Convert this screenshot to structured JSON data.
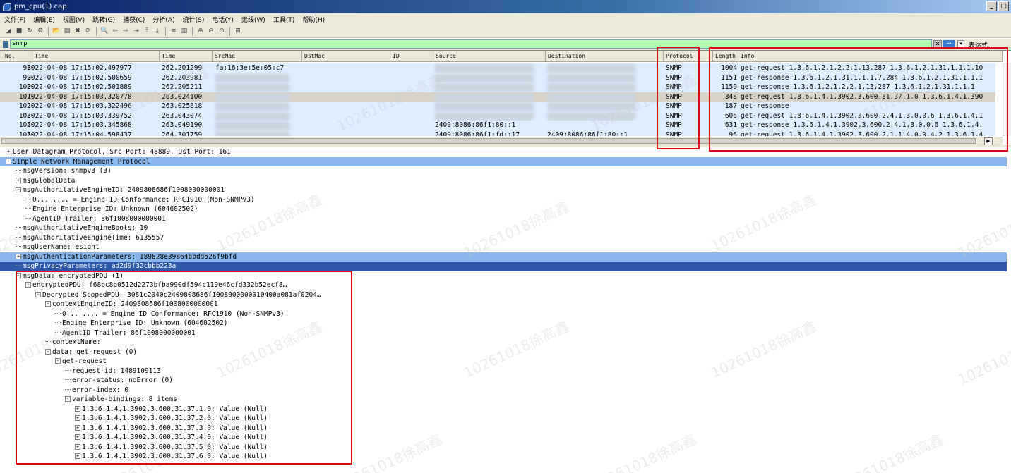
{
  "window": {
    "title": "pm_cpu(1).cap",
    "min_label": "_",
    "max_label": "□"
  },
  "menu": [
    "文件(F)",
    "编辑(E)",
    "视图(V)",
    "跳转(G)",
    "捕获(C)",
    "分析(A)",
    "统计(S)",
    "电话(Y)",
    "无线(W)",
    "工具(T)",
    "帮助(H)"
  ],
  "toolbar_icons": [
    "shark-fin-icon",
    "stop-icon",
    "restart-icon",
    "options-icon",
    "open-folder-icon",
    "save-icon",
    "close-file-icon",
    "reload-icon",
    "find-icon",
    "back-icon",
    "forward-icon",
    "goto-icon",
    "first-icon",
    "last-icon",
    "autoscroll-icon",
    "colorize-icon",
    "zoom-in-icon",
    "zoom-out-icon",
    "zoom-reset-icon",
    "resize-columns-icon"
  ],
  "filter": {
    "value": "snmp",
    "expression_label": "表达式…",
    "clear": "✕",
    "apply": "→",
    "drop": "▾"
  },
  "columns": [
    "No.",
    "Time",
    "Time",
    "SrcMac",
    "DstMac",
    "ID",
    "Source",
    "Destination",
    "Protocol",
    "Length",
    "Info"
  ],
  "packets": [
    {
      "no": "98",
      "time": "2022-04-08 17:15:02.497977",
      "rel": "262.201299",
      "srcmac": "fa:16:3e:5e:05:c7",
      "source": "",
      "dest": "",
      "proto": "SNMP",
      "len": "1004",
      "info": "get-request 1.3.6.1.2.1.2.2.1.13.287 1.3.6.1.2.1.31.1.1.1.10"
    },
    {
      "no": "99",
      "time": "2022-04-08 17:15:02.500659",
      "rel": "262.203981",
      "srcmac": "",
      "source": "",
      "dest": "",
      "proto": "SNMP",
      "len": "1151",
      "info": "get-response 1.3.6.1.2.1.31.1.1.1.7.284 1.3.6.1.2.1.31.1.1.1"
    },
    {
      "no": "100",
      "time": "2022-04-08 17:15:02.501889",
      "rel": "262.205211",
      "srcmac": "",
      "source": "",
      "dest": "",
      "proto": "SNMP",
      "len": "1159",
      "info": "get-response 1.3.6.1.2.1.2.2.1.13.287 1.3.6.1.2.1.31.1.1.1"
    },
    {
      "no": "101",
      "time": "2022-04-08 17:15:03.320778",
      "rel": "263.024100",
      "srcmac": "",
      "source": "",
      "dest": "",
      "proto": "SNMP",
      "len": "348",
      "info": "get-request 1.3.6.1.4.1.3902.3.600.31.37.1.0 1.3.6.1.4.1.390"
    },
    {
      "no": "102",
      "time": "2022-04-08 17:15:03.322496",
      "rel": "263.025818",
      "srcmac": "",
      "source": "",
      "dest": "",
      "proto": "SNMP",
      "len": "187",
      "info": "get-response"
    },
    {
      "no": "103",
      "time": "2022-04-08 17:15:03.339752",
      "rel": "263.043074",
      "srcmac": "",
      "source": "",
      "dest": "",
      "proto": "SNMP",
      "len": "606",
      "info": "get-request 1.3.6.1.4.1.3902.3.600.2.4.1.3.0.0.6 1.3.6.1.4.1"
    },
    {
      "no": "104",
      "time": "2022-04-08 17:15:03.345868",
      "rel": "263.049190",
      "srcmac": "",
      "source": "2409:8086:86f1:80::1",
      "dest": "",
      "proto": "SNMP",
      "len": "631",
      "info": "get-response 1.3.6.1.4.1.3902.3.600.2.4.1.3.0.0.6 1.3.6.1.4."
    },
    {
      "no": "106",
      "time": "2022-04-08 17:15:04.598437",
      "rel": "264.301759",
      "srcmac": "",
      "source": "2409:8086:86f1:fd::17",
      "dest": "2409:8086:86f1:80::1",
      "proto": "SNMP",
      "len": "96",
      "info": "get-request 1.3.6.1.4.1.3902.3.600.2.1.1.4.0.0.4.2 1.3.6.1.4"
    }
  ],
  "details": [
    {
      "indent": 0,
      "exp": "+",
      "text": "User Datagram Protocol, Src Port: 48889, Dst Port: 161",
      "hl": ""
    },
    {
      "indent": 0,
      "exp": "-",
      "text": "Simple Network Management Protocol",
      "hl": "light"
    },
    {
      "indent": 1,
      "exp": "",
      "text": "msgVersion: snmpv3 (3)",
      "hl": ""
    },
    {
      "indent": 1,
      "exp": "+",
      "text": "msgGlobalData",
      "hl": ""
    },
    {
      "indent": 1,
      "exp": "-",
      "text": "msgAuthoritativeEngineID: 2409808686f1008000000001",
      "hl": ""
    },
    {
      "indent": 2,
      "exp": "",
      "text": "0... .... = Engine ID Conformance: RFC1910 (Non-SNMPv3)",
      "hl": ""
    },
    {
      "indent": 2,
      "exp": "",
      "text": "Engine Enterprise ID: Unknown (604602502)",
      "hl": ""
    },
    {
      "indent": 2,
      "exp": "",
      "text": "AgentID Trailer: 86f1008000000001",
      "hl": ""
    },
    {
      "indent": 1,
      "exp": "",
      "text": "msgAuthoritativeEngineBoots: 10",
      "hl": ""
    },
    {
      "indent": 1,
      "exp": "",
      "text": "msgAuthoritativeEngineTime: 6135557",
      "hl": ""
    },
    {
      "indent": 1,
      "exp": "",
      "text": "msgUserName: esight",
      "hl": ""
    },
    {
      "indent": 1,
      "exp": "+",
      "text": "msgAuthenticationParameters: 189828e39864bbdd526f9bfd",
      "hl": "light"
    },
    {
      "indent": 1,
      "exp": "",
      "text": "msgPrivacyParameters: ad2d9f32cbbb223a",
      "hl": "dark"
    },
    {
      "indent": 1,
      "exp": "-",
      "text": "msgData: encryptedPDU (1)",
      "hl": ""
    },
    {
      "indent": 2,
      "exp": "-",
      "text": "encryptedPDU: f68bc8b0512d2273bfba990df594c119e46cfd332b52ecf8…",
      "hl": ""
    },
    {
      "indent": 3,
      "exp": "-",
      "text": "Decrypted ScopedPDU: 3081c2040c2409808686f1008000000010400a081af0204…",
      "hl": ""
    },
    {
      "indent": 4,
      "exp": "-",
      "text": "contextEngineID: 2409808686f1008000000001",
      "hl": ""
    },
    {
      "indent": 5,
      "exp": "",
      "text": "0... .... = Engine ID Conformance: RFC1910 (Non-SNMPv3)",
      "hl": ""
    },
    {
      "indent": 5,
      "exp": "",
      "text": "Engine Enterprise ID: Unknown (604602502)",
      "hl": ""
    },
    {
      "indent": 5,
      "exp": "",
      "text": "AgentID Trailer: 86f1008000000001",
      "hl": ""
    },
    {
      "indent": 4,
      "exp": "",
      "text": "contextName:",
      "hl": ""
    },
    {
      "indent": 4,
      "exp": "-",
      "text": "data: get-request (0)",
      "hl": ""
    },
    {
      "indent": 5,
      "exp": "-",
      "text": "get-request",
      "hl": ""
    },
    {
      "indent": 6,
      "exp": "",
      "text": "request-id: 1489109113",
      "hl": ""
    },
    {
      "indent": 6,
      "exp": "",
      "text": "error-status: noError (0)",
      "hl": ""
    },
    {
      "indent": 6,
      "exp": "",
      "text": "error-index: 0",
      "hl": ""
    },
    {
      "indent": 6,
      "exp": "-",
      "text": "variable-bindings: 8 items",
      "hl": ""
    },
    {
      "indent": 7,
      "exp": "+",
      "text": "1.3.6.1.4.1.3902.3.600.31.37.1.0: Value (Null)",
      "hl": ""
    },
    {
      "indent": 7,
      "exp": "+",
      "text": "1.3.6.1.4.1.3902.3.600.31.37.2.0: Value (Null)",
      "hl": ""
    },
    {
      "indent": 7,
      "exp": "+",
      "text": "1.3.6.1.4.1.3902.3.600.31.37.3.0: Value (Null)",
      "hl": ""
    },
    {
      "indent": 7,
      "exp": "+",
      "text": "1.3.6.1.4.1.3902.3.600.31.37.4.0: Value (Null)",
      "hl": ""
    },
    {
      "indent": 7,
      "exp": "+",
      "text": "1.3.6.1.4.1.3902.3.600.31.37.5.0: Value (Null)",
      "hl": ""
    },
    {
      "indent": 7,
      "exp": "+",
      "text": "1.3.6.1.4.1.3902.3.600.31.37.6.0: Value (Null)",
      "hl": ""
    }
  ],
  "watermark": "10261018徐高鑫",
  "colors": {
    "filter_bg": "#afffaf",
    "row_bg": "#dceeff",
    "selected_row": "#d9d2c7",
    "highlight_light": "#88b8ec",
    "highlight_dark": "#2e58a8",
    "annotation": "#e3000f"
  }
}
